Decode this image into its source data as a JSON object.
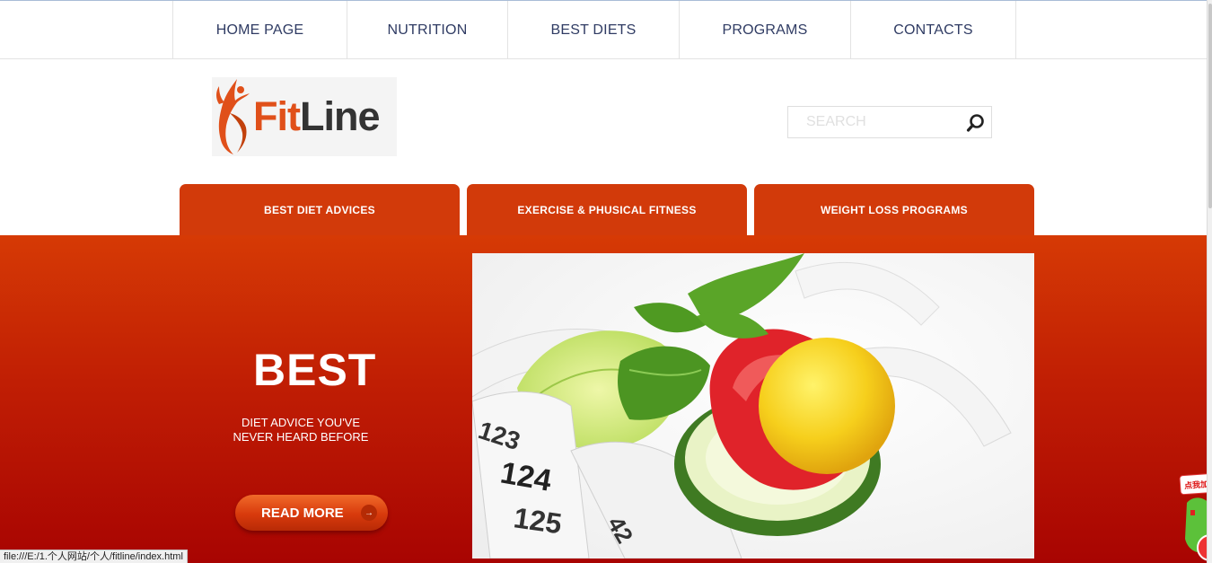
{
  "nav": {
    "items": [
      {
        "label": "HOME PAGE"
      },
      {
        "label": "NUTRITION"
      },
      {
        "label": "BEST DIETS"
      },
      {
        "label": "PROGRAMS"
      },
      {
        "label": "CONTACTS"
      }
    ]
  },
  "logo": {
    "part1": "Fit",
    "part2": "Line"
  },
  "search": {
    "placeholder": "SEARCH",
    "value": ""
  },
  "tabs": [
    {
      "label": "BEST DIET ADVICES"
    },
    {
      "label": "EXERCISE & PHUSICAL FITNESS"
    },
    {
      "label": "WEIGHT LOSS PROGRAMS"
    }
  ],
  "hero": {
    "heading": "BEST",
    "subtitle_line1": "DIET ADVICE YOU'VE",
    "subtitle_line2": "NEVER HEARD BEFORE",
    "button_label": "READ MORE",
    "button_arrow": "→",
    "tape_numbers": [
      "123",
      "124",
      "125",
      "42"
    ]
  },
  "status_bar": {
    "url": "file:///E:/1.个人网站/个人/fitline/index.html"
  },
  "widget": {
    "text": "点我加"
  },
  "colors": {
    "brand_orange": "#e0501a",
    "tab_red": "#d23a0a",
    "hero_top": "#d63a05",
    "hero_bottom": "#a80402",
    "nav_text": "#2f3b63"
  },
  "icons": {
    "search": "magnifier-icon",
    "logo": "dancer-figure-icon",
    "button_arrow": "arrow-right-icon"
  }
}
